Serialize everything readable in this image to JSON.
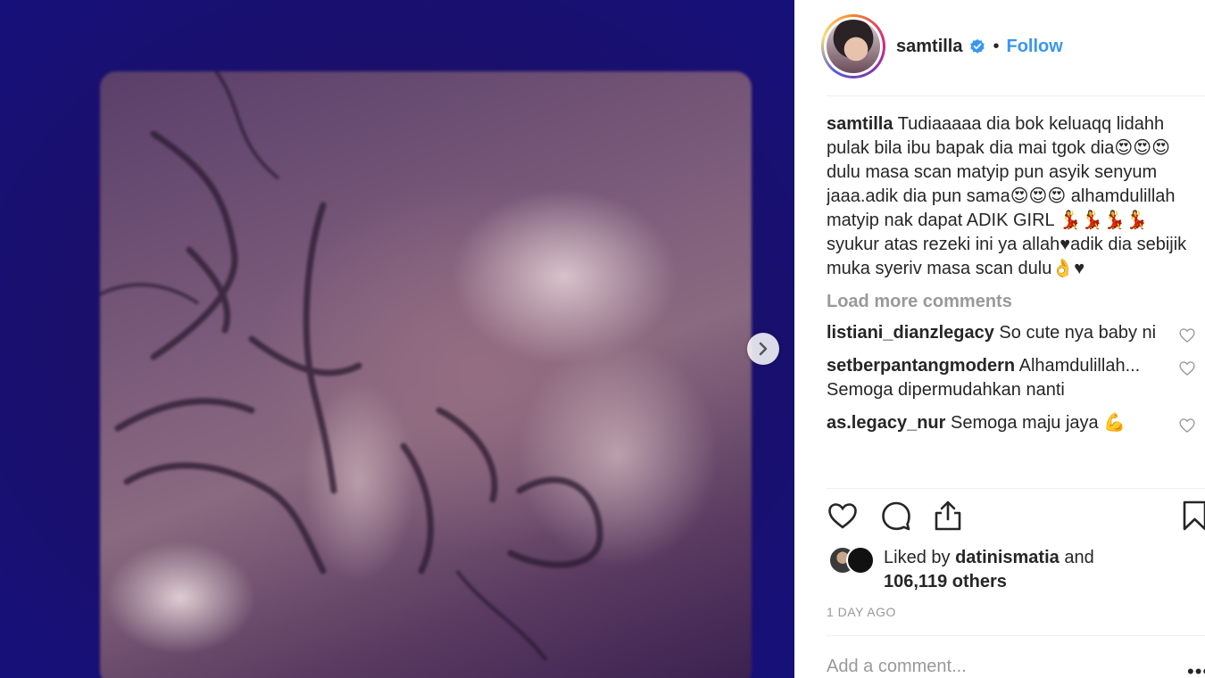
{
  "post": {
    "username": "samtilla",
    "follow_label": "Follow",
    "separator": "•"
  },
  "caption": {
    "username": "samtilla",
    "text": "Tudiaaaaa dia bok keluaqq lidahh pulak bila ibu bapak dia mai tgok dia😍😍😍dulu masa scan matyip pun asyik senyum jaaa.adik dia pun sama😍😍😍 alhamdulillah matyip nak dapat ADIK GIRL 💃💃💃💃syukur atas rezeki ini ya allah♥adik dia sebijik muka syeriv masa scan dulu👌♥"
  },
  "load_more": "Load more comments",
  "comments": [
    {
      "username": "listiani_dianzlegacy",
      "text": "So cute nya baby ni"
    },
    {
      "username": "setberpantangmodern",
      "text": "Alhamdulillah... Semoga dipermudahkan nanti"
    },
    {
      "username": "as.legacy_nur",
      "text": "Semoga maju jaya 💪"
    }
  ],
  "likes": {
    "prefix": "Liked by",
    "user": "datinismatia",
    "conj": "and",
    "count": "106,119 others"
  },
  "timestamp": "1 DAY AGO",
  "add_comment_placeholder": "Add a comment...",
  "more_icon": "•••",
  "colors": {
    "link": "#3897f0",
    "text": "#262626",
    "muted": "#999999"
  },
  "icons": [
    "heart-icon",
    "comment-icon",
    "share-icon",
    "bookmark-icon",
    "verified-icon",
    "chevron-right-icon"
  ]
}
